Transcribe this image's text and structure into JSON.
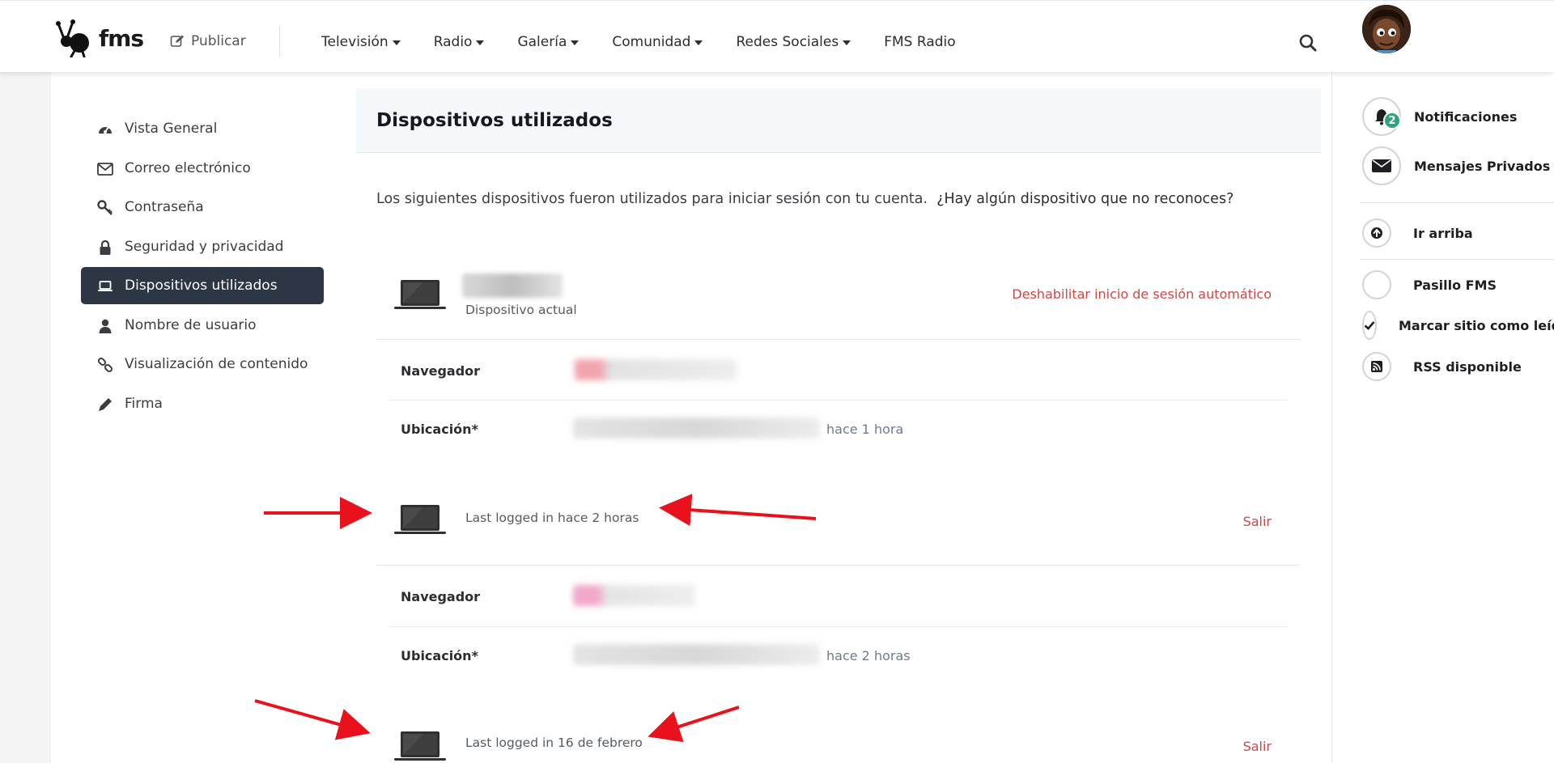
{
  "header": {
    "logo_text": "fms",
    "publish_label": "Publicar",
    "nav": [
      {
        "label": "Televisión",
        "dropdown": true
      },
      {
        "label": "Radio",
        "dropdown": true
      },
      {
        "label": "Galería",
        "dropdown": true
      },
      {
        "label": "Comunidad",
        "dropdown": true
      },
      {
        "label": "Redes Sociales",
        "dropdown": true
      },
      {
        "label": "FMS Radio",
        "dropdown": false
      }
    ]
  },
  "sidebar": {
    "items": [
      {
        "label": "Vista General",
        "icon": "dashboard-icon"
      },
      {
        "label": "Correo electrónico",
        "icon": "envelope-icon"
      },
      {
        "label": "Contraseña",
        "icon": "key-icon"
      },
      {
        "label": "Seguridad y privacidad",
        "icon": "lock-icon"
      },
      {
        "label": "Dispositivos utilizados",
        "icon": "laptop-icon",
        "active": true
      },
      {
        "label": "Nombre de usuario",
        "icon": "user-icon"
      },
      {
        "label": "Visualización de contenido",
        "icon": "link-icon"
      },
      {
        "label": "Firma",
        "icon": "pencil-icon"
      }
    ]
  },
  "content": {
    "title": "Dispositivos utilizados",
    "intro": "Los siguientes dispositivos fueron utilizados para iniciar sesión con tu cuenta.",
    "intro_link": "¿Hay algún dispositivo que no reconoces?",
    "devices": [
      {
        "status": "Dispositivo actual",
        "action": "Deshabilitar inicio de sesión automático",
        "browser_label": "Navegador",
        "location_label": "Ubicación*",
        "location_time": "hace 1 hora"
      },
      {
        "status": "Last logged in hace 2 horas",
        "action": "Salir",
        "browser_label": "Navegador",
        "location_label": "Ubicación*",
        "location_time": "hace 2 horas"
      },
      {
        "status": "Last logged in 16 de febrero",
        "action": "Salir"
      }
    ]
  },
  "rail": {
    "notifications_label": "Notificaciones",
    "notifications_count": "2",
    "messages_label": "Mensajes Privados",
    "top_label": "Ir arriba",
    "hall_label": "Pasillo FMS",
    "mark_read_label": "Marcar sitio como leído",
    "rss_label": "RSS disponible"
  },
  "colors": {
    "active_bg": "#2d3645",
    "danger": "#d14545",
    "badge": "#2fa37c",
    "annotation_arrow": "#e8111c"
  }
}
